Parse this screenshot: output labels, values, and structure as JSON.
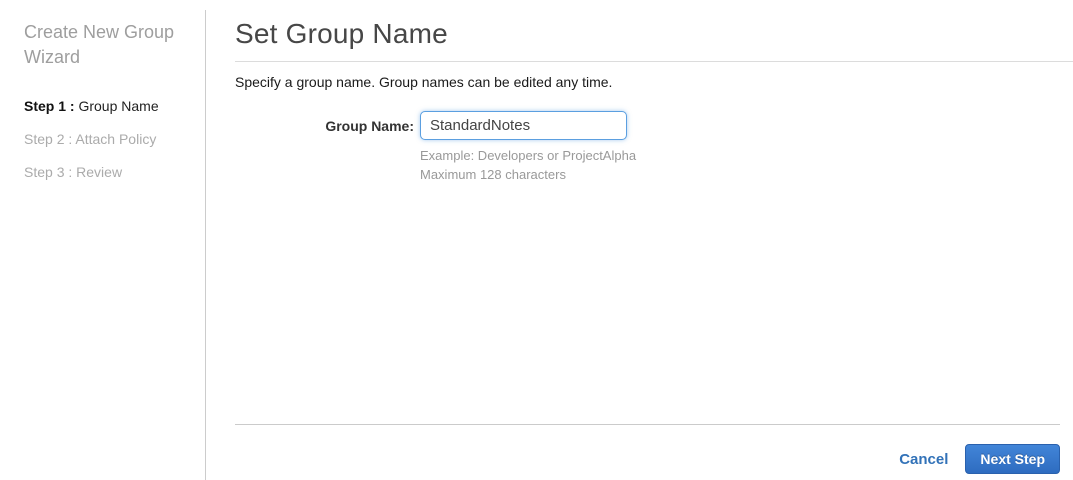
{
  "sidebar": {
    "title": "Create New Group Wizard",
    "steps": [
      {
        "prefix": "Step 1 :",
        "label": "Group Name",
        "active": true
      },
      {
        "prefix": "Step 2 :",
        "label": "Attach Policy",
        "active": false
      },
      {
        "prefix": "Step 3 :",
        "label": "Review",
        "active": false
      }
    ]
  },
  "main": {
    "title": "Set Group Name",
    "description": "Specify a group name. Group names can be edited any time.",
    "form": {
      "label": "Group Name:",
      "value": "StandardNotes",
      "hint_example": "Example: Developers or ProjectAlpha",
      "hint_max": "Maximum 128 characters"
    },
    "footer": {
      "cancel_label": "Cancel",
      "next_label": "Next Step"
    }
  },
  "colors": {
    "accent_blue": "#3272b8",
    "button_gradient_top": "#4285d8",
    "button_gradient_bottom": "#2e6cc0",
    "button_border": "#2a61ad",
    "input_focus_border": "#5b9fe0",
    "muted_text": "#999999",
    "inactive_step_text": "#ababab",
    "divider": "#cccccc"
  }
}
